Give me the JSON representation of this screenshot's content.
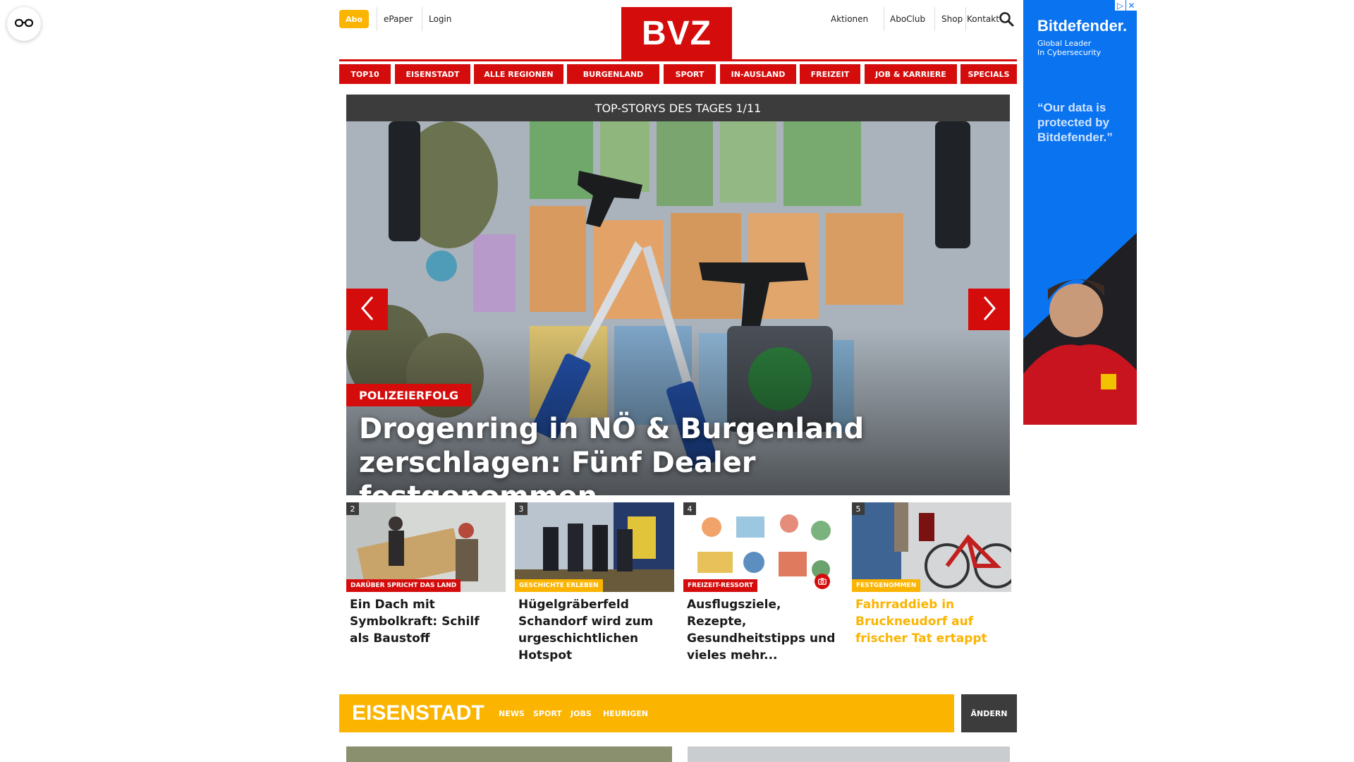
{
  "topbar": {
    "abo": "Abo",
    "epaper": "ePaper",
    "login": "Login",
    "logo": "BVZ",
    "aktionen": "Aktionen",
    "aboclub": "AboClub",
    "shop": "Shop",
    "kontakt": "Kontakt"
  },
  "nav": {
    "items": [
      "TOP10",
      "EISENSTADT",
      "ALLE REGIONEN",
      "BURGENLAND",
      "SPORT",
      "IN-AUSLAND",
      "FREIZEIT",
      "JOB & KARRIERE",
      "SPECIALS"
    ]
  },
  "hero": {
    "header": "TOP-STORYS DES TAGES 1/11",
    "badge": "POLIZEIERFOLG",
    "title": "Drogenring in NÖ & Burgenland zerschlagen: Fünf Dealer festgenommen"
  },
  "cards": [
    {
      "num": "2",
      "tag": "DARÜBER SPRICHT DAS LAND",
      "title": "Ein Dach mit Symbolkraft: Schilf als Baustoff",
      "tag_color": "#d40c0c",
      "title_color": "#1a1a1a"
    },
    {
      "num": "3",
      "tag": "GESCHICHTE ERLEBEN",
      "title": "Hügelgräberfeld Schandorf wird zum urgeschichtlichen Hotspot",
      "tag_color": "#fbb400",
      "title_color": "#1a1a1a"
    },
    {
      "num": "4",
      "tag": "FREIZEIT-RESSORT",
      "title": "Ausflugsziele, Rezepte, Gesundheitstipps und vieles mehr...",
      "tag_color": "#d40c0c",
      "title_color": "#1a1a1a"
    },
    {
      "num": "5",
      "tag": "FESTGENOMMEN",
      "title": "Fahrraddieb in Bruckneudorf auf frischer Tat ertappt",
      "tag_color": "#fbb400",
      "title_color": "#fbb400"
    }
  ],
  "region": {
    "title": "EISENSTADT",
    "links": [
      "NEWS",
      "SPORT",
      "JOBS",
      "HEURIGEN"
    ],
    "change": "ÄNDERN"
  },
  "ad": {
    "brand": "Bitdefender.",
    "tagline1": "Global Leader",
    "tagline2": "In Cybersecurity",
    "quote": "“Our data is protected by Bitdefender.”"
  },
  "colors": {
    "brand_red": "#d40c0c",
    "region_yellow": "#fbb400",
    "dark": "#3c3c3c",
    "ad_blue": "#0a73f0"
  }
}
